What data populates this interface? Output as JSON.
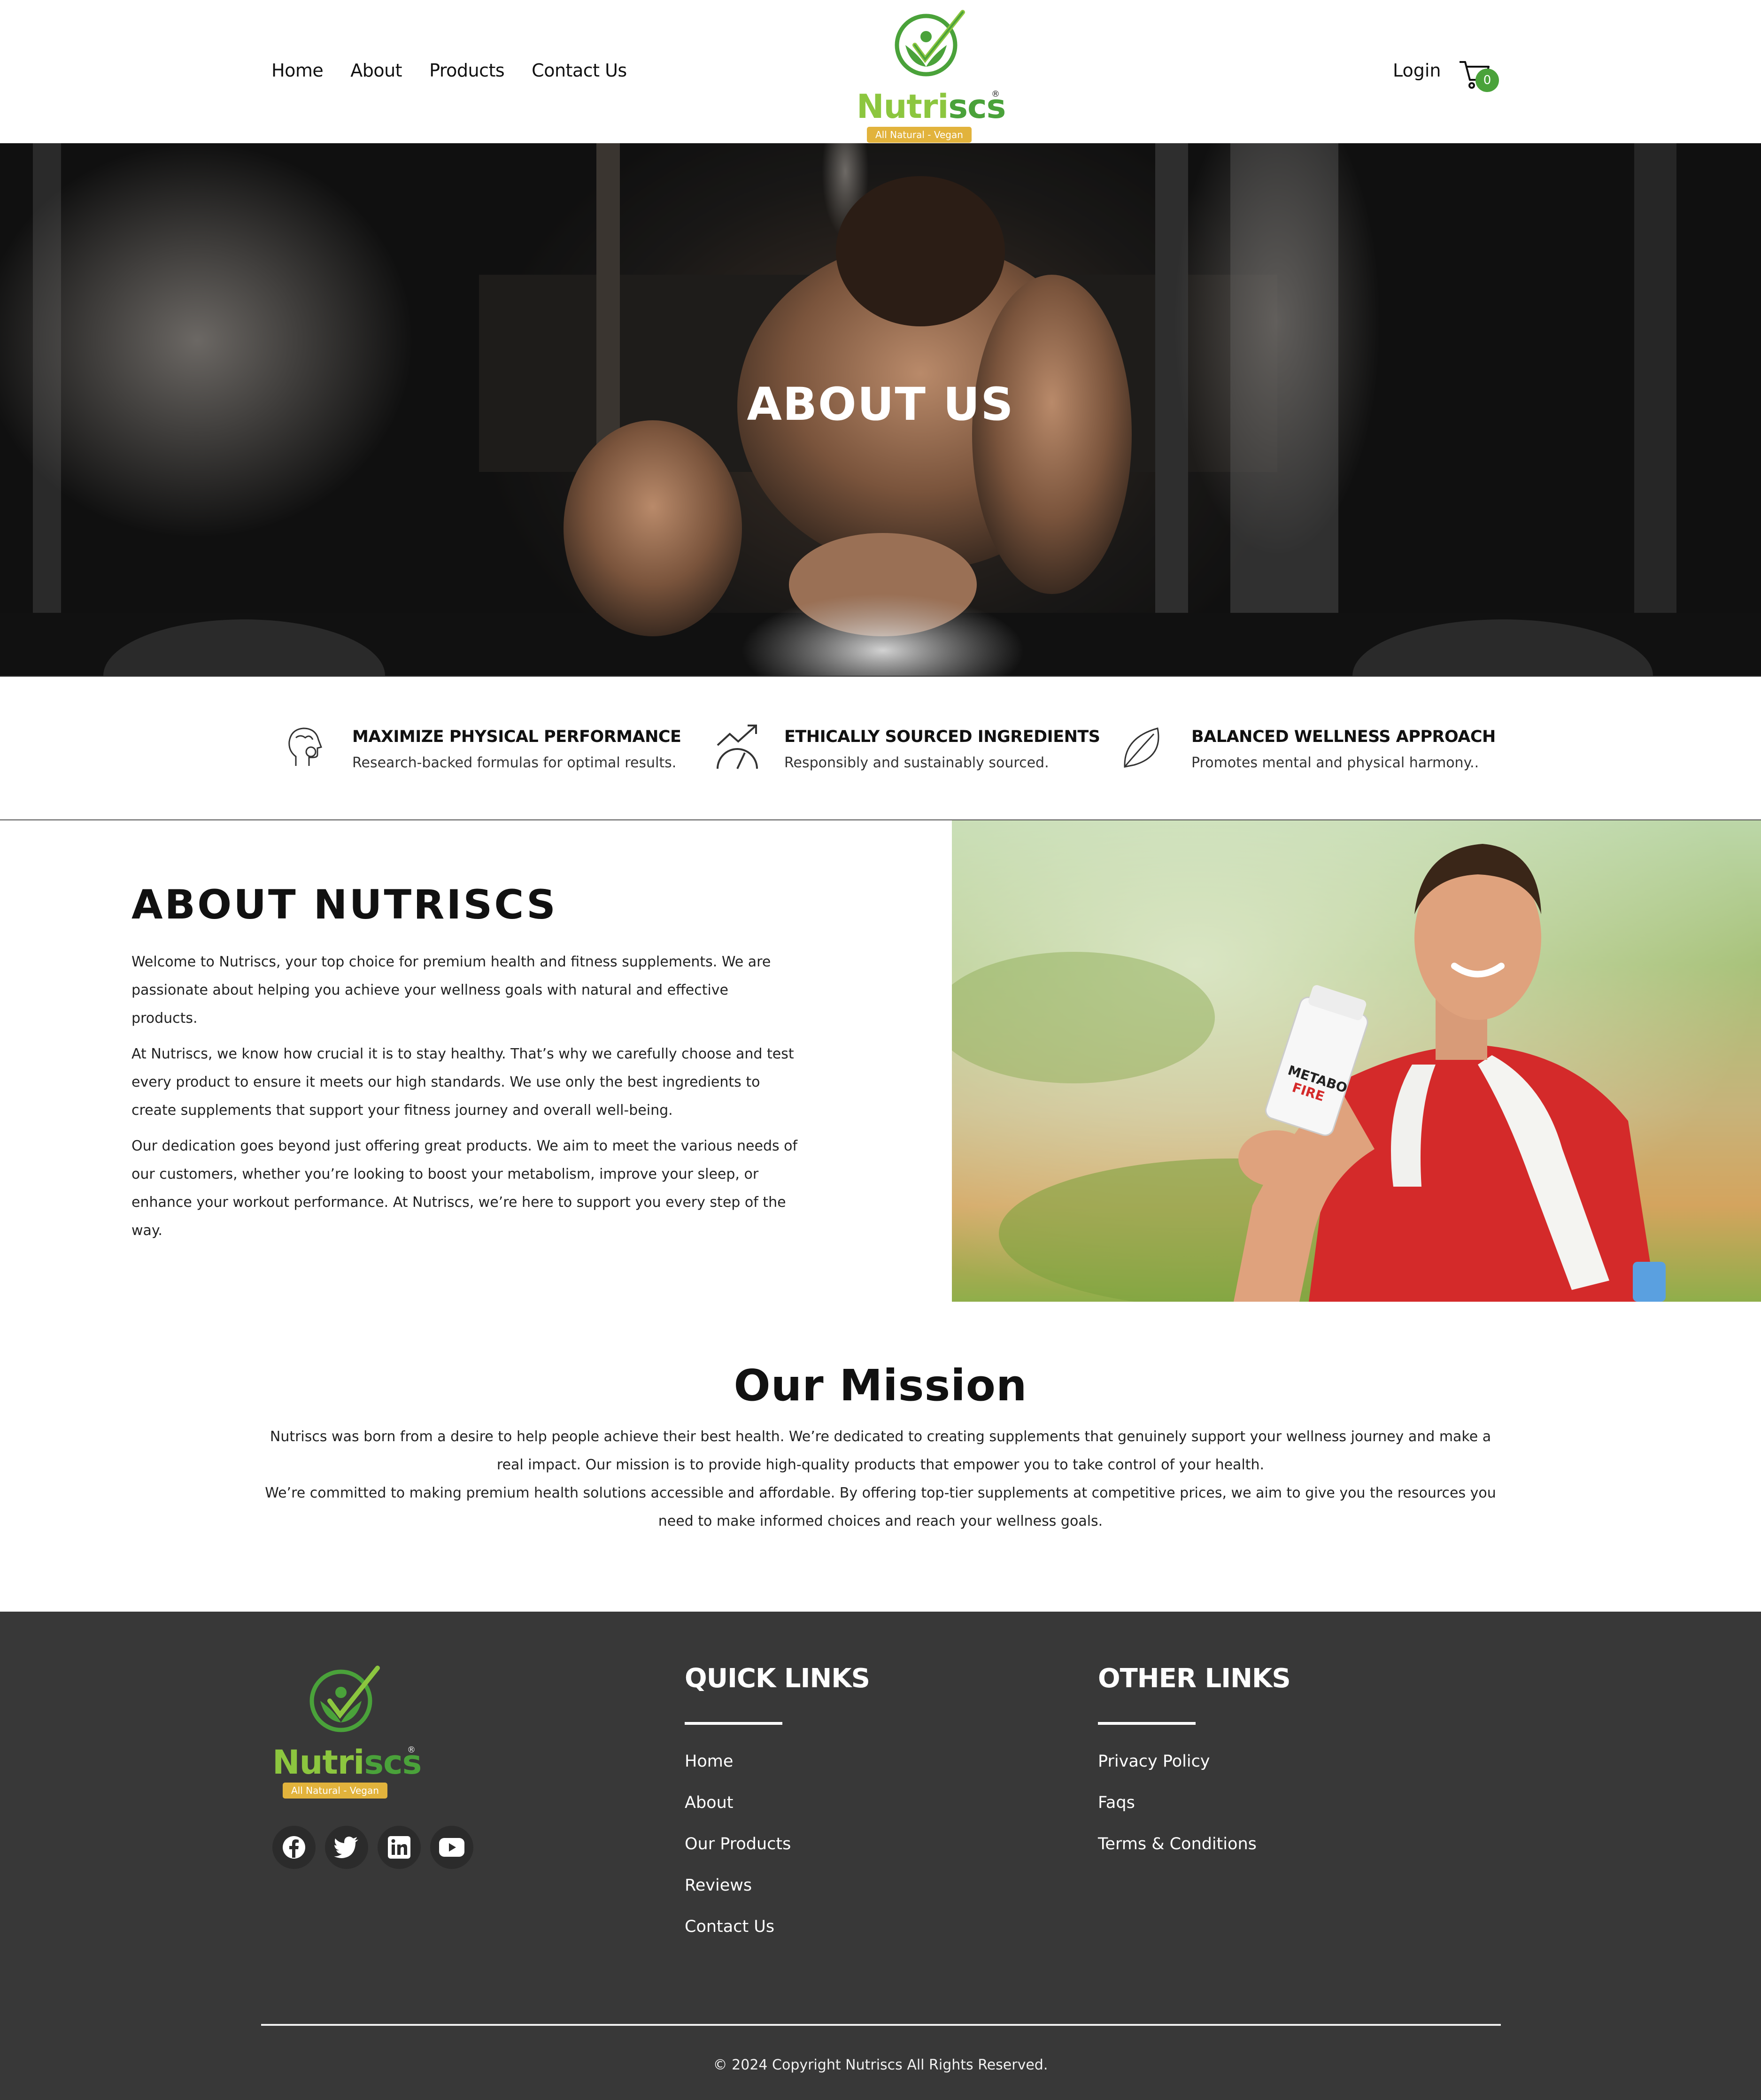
{
  "header": {
    "nav": [
      "Home",
      "About",
      "Products",
      "Contact Us"
    ],
    "logo_word_a": "Nutri",
    "logo_word_b": "scs",
    "logo_reg": "®",
    "logo_tagline": "All Natural - Vegan",
    "login": "Login",
    "cart_count": "0"
  },
  "hero": {
    "title": "ABOUT US"
  },
  "features": [
    {
      "icon": "head-brain-icon",
      "title": "MAXIMIZE PHYSICAL PERFORMANCE",
      "text": "Research-backed formulas for optimal results."
    },
    {
      "icon": "trend-gauge-icon",
      "title": "ETHICALLY SOURCED INGREDIENTS",
      "text": "Responsibly and sustainably sourced."
    },
    {
      "icon": "leaf-icon",
      "title": "BALANCED WELLNESS APPROACH",
      "text": "Promotes mental and physical harmony.."
    }
  ],
  "about": {
    "title": "ABOUT NUTRISCS",
    "paragraphs": [
      "Welcome to Nutriscs, your top choice for premium health and fitness supplements. We are passionate about helping you achieve your wellness goals with natural and effective products.",
      "At Nutriscs, we know how crucial it is to stay healthy. That’s why we carefully choose and test every product to ensure it meets our high standards. We use only the best ingredients to create supplements that support your fitness journey and overall well-being.",
      "Our dedication goes beyond just offering great products. We aim to meet the various needs of our customers, whether you’re looking to boost your metabolism, improve your sleep, or enhance your workout performance. At Nutriscs, we’re here to support you every step of the way."
    ],
    "bottle_label_a": "METABO",
    "bottle_label_b": "FIRE"
  },
  "mission": {
    "title": "Our Mission",
    "line1": "Nutriscs was born from a desire to help people achieve their best health. We’re dedicated to creating supplements that genuinely support your wellness journey and make a real impact. Our mission is to provide high-quality products that empower you to take control of your health.",
    "line2": "We’re committed to making premium health solutions accessible and affordable. By offering top-tier supplements at competitive prices, we aim to give you the resources you need to make informed choices and reach your wellness goals."
  },
  "footer": {
    "quick_title": "QUICK LINKS",
    "quick_links": [
      "Home",
      "About",
      "Our Products",
      "Reviews",
      "Contact Us"
    ],
    "other_title": "OTHER LINKS",
    "other_links": [
      "Privacy Policy",
      "Faqs",
      "Terms & Conditions"
    ],
    "socials": [
      "facebook-icon",
      "twitter-icon",
      "linkedin-icon",
      "youtube-icon"
    ],
    "copyright": "© 2024 Copyright Nutriscs All Rights Reserved."
  },
  "colors": {
    "brand_green": "#4aa23a",
    "brand_lime": "#8cc63f",
    "tag_gold": "#e2b33c",
    "footer_bg": "#383838"
  }
}
